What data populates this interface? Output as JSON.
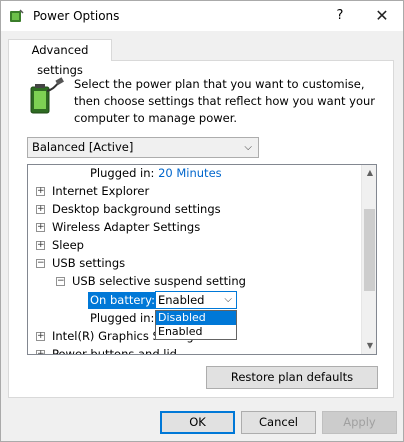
{
  "window": {
    "title": "Power Options",
    "help_glyph": "?",
    "close_glyph": "✕"
  },
  "tab": {
    "label": "Advanced settings"
  },
  "description": "Select the power plan that you want to customise, then choose settings that reflect how you want your computer to manage power.",
  "plan_select": {
    "value": "Balanced [Active]",
    "chevron": "⌵"
  },
  "tree": {
    "plugged_in_top": {
      "label": "Plugged in:",
      "value": "20 Minutes"
    },
    "items": [
      {
        "label": "Internet Explorer",
        "expander": "+"
      },
      {
        "label": "Desktop background settings",
        "expander": "+"
      },
      {
        "label": "Wireless Adapter Settings",
        "expander": "+"
      },
      {
        "label": "Sleep",
        "expander": "+"
      },
      {
        "label": "USB settings",
        "expander": "−"
      }
    ],
    "usb_child": {
      "label": "USB selective suspend setting",
      "expander": "−"
    },
    "on_battery": {
      "label": "On battery:",
      "value": "Enabled",
      "chevron": "⌵"
    },
    "dropdown_options": [
      {
        "label": "Disabled",
        "selected": true
      },
      {
        "label": "Enabled",
        "selected": false
      }
    ],
    "plugged_in_bottom": {
      "label": "Plugged in:"
    },
    "intel_item": {
      "label": "Intel(R) Graphics Settings",
      "expander": "+"
    },
    "power_buttons": {
      "label": "Power buttons and lid",
      "expander": "+"
    }
  },
  "scrollbar": {
    "up": "▲",
    "down": "▼"
  },
  "buttons": {
    "restore": "Restore plan defaults",
    "ok": "OK",
    "cancel": "Cancel",
    "apply": "Apply"
  },
  "colors": {
    "accent": "#0078d7",
    "link": "#0066cc"
  }
}
